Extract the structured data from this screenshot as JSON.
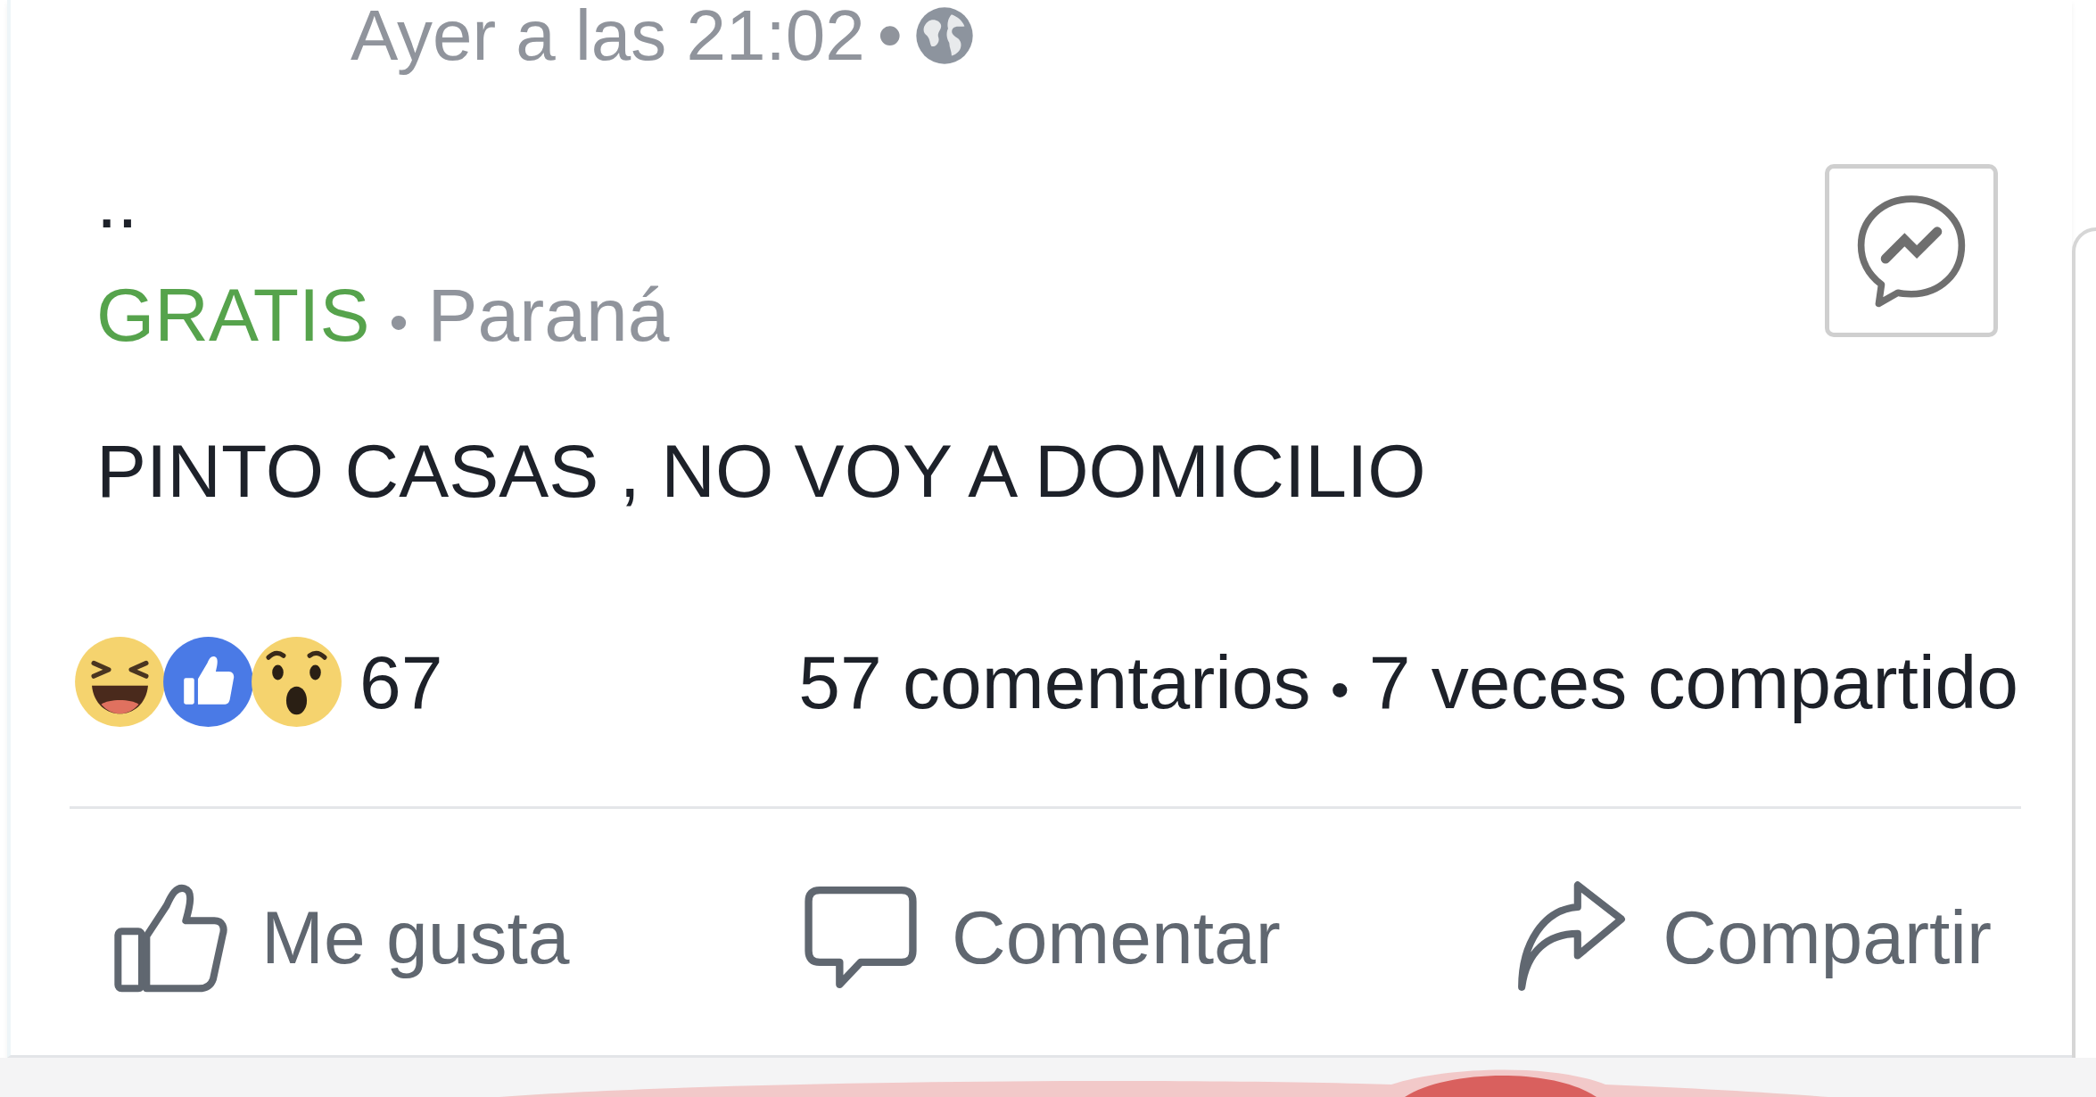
{
  "post": {
    "timestamp": "Ayer a las 21:02",
    "timestamp_separator": "•",
    "heading": "..",
    "price": "GRATIS",
    "location_separator": "•",
    "location": "Paraná",
    "text": "PINTO CASAS , NO VOY A DOMICILIO"
  },
  "reactions": {
    "items": [
      {
        "kind": "haha"
      },
      {
        "kind": "like"
      },
      {
        "kind": "wow"
      }
    ],
    "count": "67"
  },
  "stats": {
    "comments": "57 comentarios",
    "separator": "•",
    "shares": "7 veces compartido"
  },
  "actions": [
    {
      "kind": "like",
      "label": "Me gusta"
    },
    {
      "kind": "comment",
      "label": "Comentar"
    },
    {
      "kind": "share",
      "label": "Compartir"
    }
  ]
}
